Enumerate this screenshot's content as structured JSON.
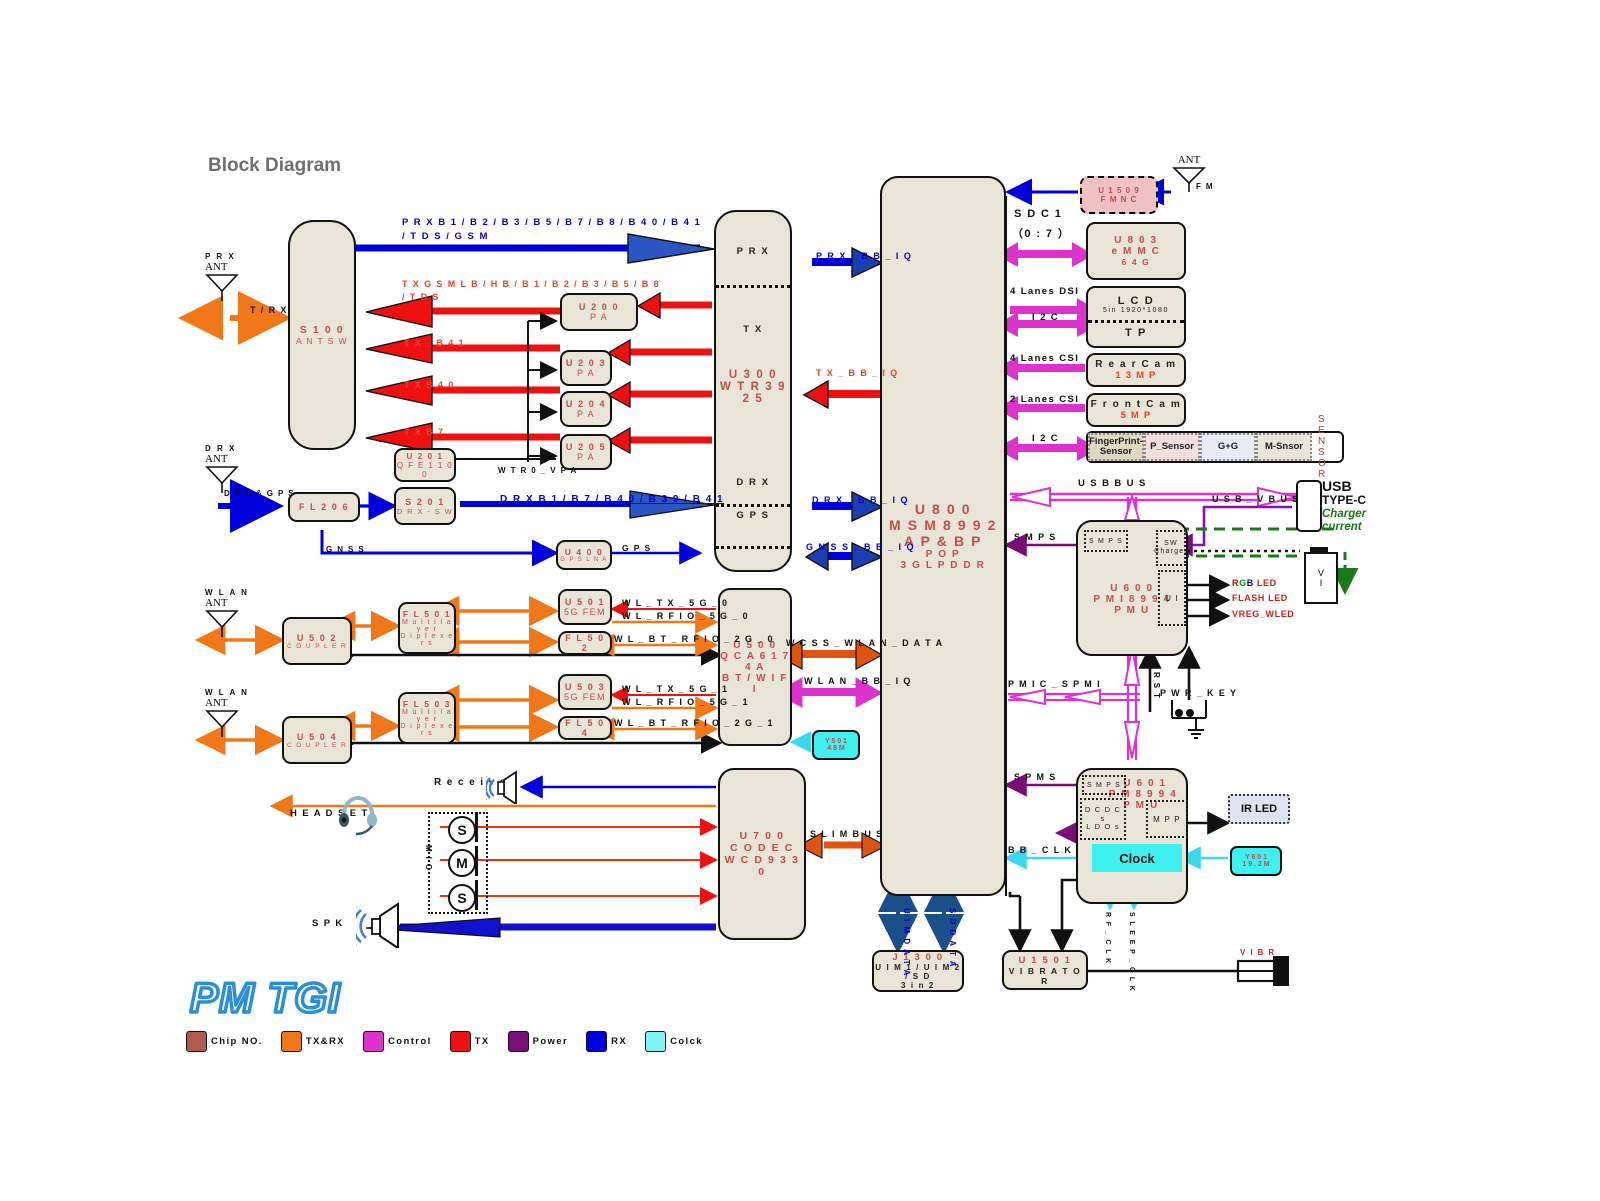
{
  "page": {
    "title": "Block Diagram",
    "watermark": "PM TGI"
  },
  "colors": {
    "block_fill": "#e8e4d6",
    "chip_text": "#c0504d",
    "rx_blue": "#0000dd",
    "tx_red": "#ee1111",
    "txrx_orange": "#f07818",
    "control_magenta": "#dd33cc",
    "power_purple": "#7a0f7a",
    "clock_cyan": "#3ff0f0",
    "chip_no_brown": "#b05a50",
    "charger_green": "#1a7a1a"
  },
  "legend": {
    "items": [
      {
        "label": "Chip NO.",
        "color": "#b05a50"
      },
      {
        "label": "TX&RX",
        "color": "#f07818"
      },
      {
        "label": "Control",
        "color": "#dd33cc"
      },
      {
        "label": "TX",
        "color": "#ee1111"
      },
      {
        "label": "Power",
        "color": "#7a0f7a"
      },
      {
        "label": "RX",
        "color": "#0000dd"
      },
      {
        "label": "Colck",
        "color": "#7ff5f5"
      }
    ]
  },
  "blocks": {
    "s100": {
      "l1": "S 1 0 0",
      "l2": "A N T  S W"
    },
    "u200": {
      "l1": "U 2 0 0",
      "l2": "P A"
    },
    "u203": {
      "l1": "U 2 0 3",
      "l2": "P A"
    },
    "u204": {
      "l1": "U 2 0 4",
      "l2": "P A"
    },
    "u205": {
      "l1": "U 2 0 5",
      "l2": "P A"
    },
    "u201": {
      "l1": "U 2 0 1",
      "l2": "Q F E 1 1 0 0"
    },
    "fl206": {
      "l1": "F L 2 0 6"
    },
    "s201": {
      "l1": "S 2 0 1",
      "l2": "D R X - S W"
    },
    "u400": {
      "l1": "U 4 0 0",
      "l2": "G P S  L N A"
    },
    "u300": {
      "l1": "U 3 0 0",
      "l2": "W T R 3 9 2 5",
      "ports": [
        "P R X",
        "T X",
        "D R X",
        "G P S"
      ]
    },
    "u800": {
      "l1": "U 8 0 0",
      "l2": "M S M 8 9 9 2",
      "l3": "A P & B P",
      "l4": "P O P",
      "l5": "3 G  L P D D R"
    },
    "u1509": {
      "l1": "U 1 5 0 9",
      "l2": "F M  N C"
    },
    "u803": {
      "l1": "U 8 0 3",
      "l2": "e M M C",
      "l3": "6 4 G"
    },
    "lcd": {
      "l1": "L C D",
      "l2": "5in  1920*1080",
      "l3": "T P"
    },
    "rearcam": {
      "l1": "R e a r  C a m",
      "l2": "1 3 M P"
    },
    "frontcam": {
      "l1": "F r o n t  C a m",
      "l2": "5 M P"
    },
    "sensors": {
      "cells": [
        "FingerPrint-Sensor",
        "P_Sensor",
        "G+G",
        "M-Snsor"
      ],
      "name": "S E N S O R"
    },
    "u502": {
      "l1": "U 5 0 2",
      "l2": "C O U P L E R"
    },
    "u504": {
      "l1": "U 5 0 4",
      "l2": "C O U P L E R"
    },
    "fl501": {
      "l1": "F L 5 0 1",
      "l2": "M u l t i l a y e r",
      "l3": "D i p l e x e r s"
    },
    "fl503": {
      "l1": "F L 5 0 3",
      "l2": "M u l t i l a y e r",
      "l3": "D i p l e x e r s"
    },
    "u501": {
      "l1": "U 5 0 1",
      "l2": "5G FEM"
    },
    "u503": {
      "l1": "U 5 0 3",
      "l2": "5G FEM"
    },
    "fl502": {
      "l1": "F L 5 0 2"
    },
    "fl504": {
      "l1": "F L 5 0 4"
    },
    "u500": {
      "l1": "U 5 0 0",
      "l2": "Q C A 6 1 7 4 A",
      "l3": "B T / W I F I"
    },
    "y501": {
      "l1": "Y 5 0 1",
      "l2": "4 8 M"
    },
    "u700": {
      "l1": "U 7 0 0",
      "l2": "C O D E C",
      "l3": "W C D 9 3 3 0"
    },
    "u600": {
      "l1": "U 6 0 0",
      "l2": "P M I 8 9 9 4",
      "l3": "P M U",
      "inner": [
        "S M P S",
        "SW\nCharger",
        "U I"
      ]
    },
    "u601": {
      "l1": "U 6 0 1",
      "l2": "P M 8 9 9 4",
      "l3": "P M U",
      "inner": [
        "S M P S",
        "D C D C s\nL D O s",
        "M P P"
      ],
      "clock": "Clock"
    },
    "y601": {
      "l1": "Y 6 0 1",
      "l2": "1 9 . 2 M"
    },
    "irled": {
      "l1": "IR LED"
    },
    "j1300": {
      "l1": "J 1 3 0 0",
      "l2": "U I M 1 / U I M 2 / S D",
      "l3": "3  i n  2"
    },
    "u1501": {
      "l1": "U 1 5 0 1",
      "l2": "V I B R A T O R"
    }
  },
  "antennas": {
    "prx": {
      "l1": "P R X",
      "l2": "ANT",
      "sig": "T / R X"
    },
    "drx": {
      "l1": "D R X",
      "l2": "ANT",
      "sig": "D R X & G P S"
    },
    "wlan1": {
      "l1": "W L A N",
      "l2": "ANT"
    },
    "wlan2": {
      "l1": "W L A N",
      "l2": "ANT"
    },
    "fm": {
      "l1": "ANT",
      "sig": "F M"
    }
  },
  "signals": {
    "prx_bands": "P R X   B 1 / B 2 / B 3 / B 5 / B 7 / B 8 / B 4 0 / B 4 1",
    "prx_bands2": "/ T D S / G S M",
    "tx_gsm": "T X  G S M  L B / H B / B 1 / B 2 / B 3 / B 5 / B 8",
    "tx_gsm2": "/ T D S",
    "tx_b41": "T X _ B 4 1",
    "tx_b40": "T X  B 4 0",
    "tx_b7": "T X  B 7",
    "wtr0_vpa": "W T R 0 _ V P A",
    "drx_bands": "D R X   B 1 / B 7 / B 4 0 / B 3 9 / B 4 1",
    "gnss": "G N S S",
    "gps": "G P S",
    "prx_bb_iq": "P R X _ B B _ I Q",
    "tx_bb_iq": "T X _ B B _ I Q",
    "drx_bb_iq": "D R X _ B B _ I Q",
    "gnss_bb_iq": "G N S S _ B B _ I Q",
    "wl_tx_5g_0": "W L _ T X _ 5 G _ 0",
    "wl_rfio_5g_0": "W L _ R F I O _ 5 G _ 0",
    "wl_bt_rfio_2g_0": "W L _ B T _ R F I O _ 2 G _ 0",
    "wl_tx_5g_1": "W L _ T X _ 5 G _ 1",
    "wl_rfio_5g_1": "W L _ R F I O _ 5 G _ 1",
    "wl_bt_rfio_2g_1": "W L _ B T _ R F I O _ 2 G _ 1",
    "wcss_wlan_data": "W C S S _ W L A N _ D A T A",
    "wlan_bb_iq": "W L A N _ B B _ I Q",
    "slimbus": "S L I M B U S",
    "sdc1": "S D C 1",
    "sdc1b": "（0 : 7 ）",
    "dsi4": "4 Lanes DSI",
    "i2c": "I 2 C",
    "csi4": "4 Lanes CSI",
    "csi2": "2 Lanes CSI",
    "i2c2": "I 2 C",
    "usb_bus": "U S B  B U S",
    "usb_vbus": "U S B _ V B U S",
    "smps": "S M P S",
    "pmic_spmi": "P M I C _ S P M I",
    "spms": "S P M S",
    "bb_clk": "B B _ C L K",
    "rst": "R S T",
    "pwr_key": "P W R _ K E Y",
    "rf_clk": "R F _ C L K",
    "sleep_clk": "S L E E P _ C L K",
    "uim_data": "U I M  D A T A",
    "sd_data": "S D  D A T A",
    "vibr": "V I B R",
    "rgb_led": "RGB LED",
    "flash_led": "FLASH LED",
    "vreg_wled": "VREG_WLED",
    "charger_current": "Charger\ncurrent",
    "usb_type_c_1": "USB",
    "usb_type_c_2": "TYPE-C",
    "battery_v": "V",
    "battery_i": "I"
  },
  "audio": {
    "receiver": "R e c e i v e r",
    "headset": "H E A D S E T",
    "mic": "M I C",
    "spk": "S P K",
    "mic_labels": [
      "S",
      "M",
      "S"
    ]
  }
}
